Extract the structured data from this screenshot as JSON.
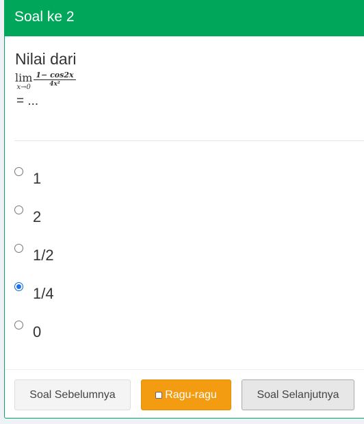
{
  "header": {
    "title": "Soal ke 2"
  },
  "question": {
    "intro": "Nilai dari",
    "limit_word": "lim",
    "limit_sub": "x→0",
    "numerator": "1− cos2x",
    "denominator": "4x²",
    "equals": "= ..."
  },
  "options": [
    {
      "label": "1",
      "checked": false
    },
    {
      "label": "2",
      "checked": false
    },
    {
      "label": "1/2",
      "checked": false
    },
    {
      "label": "1/4",
      "checked": true
    },
    {
      "label": "0",
      "checked": false
    }
  ],
  "buttons": {
    "prev_label": "Soal Sebelumnya",
    "doubt_label": "Ragu-ragu",
    "next_label": "Soal Selanjutnya"
  },
  "colors": {
    "header": "#00a65a",
    "doubt_button": "#f39c12",
    "radio_checked": "#1a73e8"
  }
}
